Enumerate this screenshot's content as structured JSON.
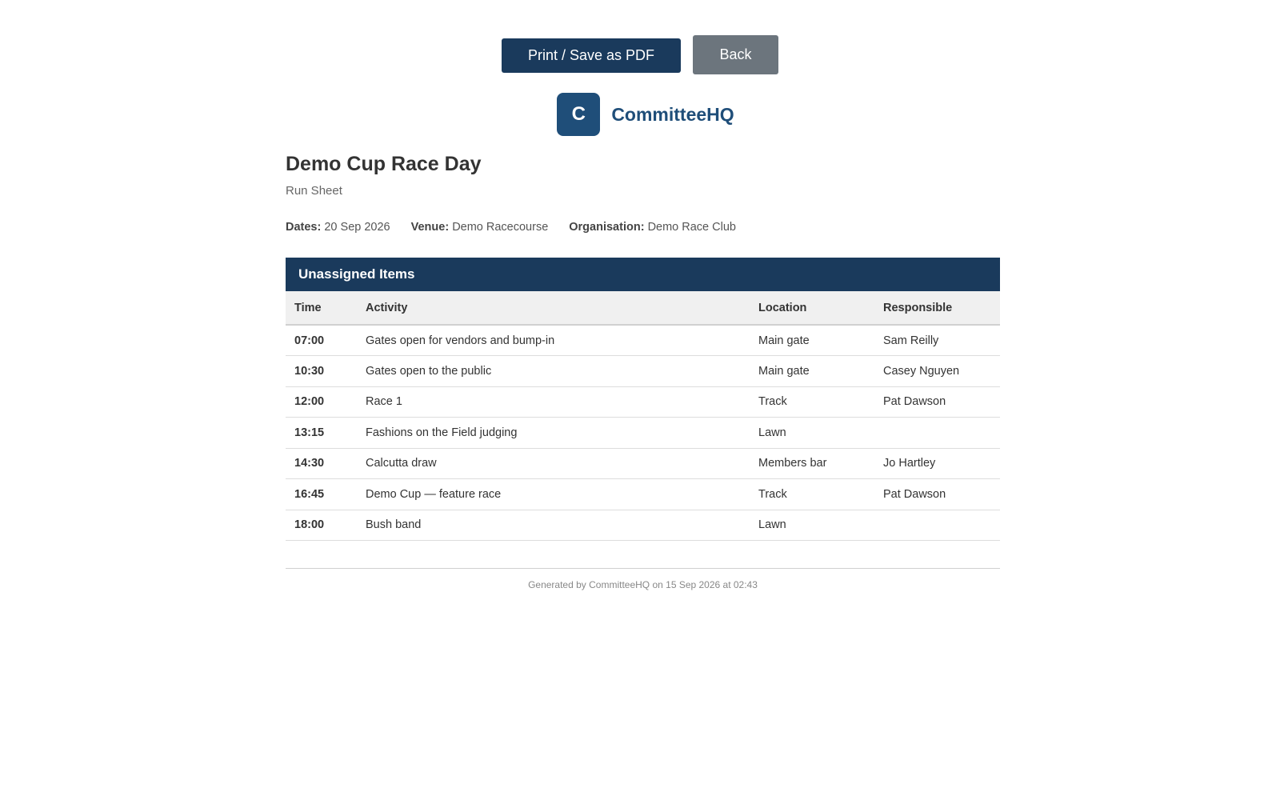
{
  "toolbar": {
    "print_label": "Print / Save as PDF",
    "back_label": "Back"
  },
  "brand": {
    "logo_letter": "C",
    "name": "CommitteeHQ"
  },
  "event": {
    "title": "Demo Cup Race Day",
    "subtitle": "Run Sheet",
    "dates_label": "Dates:",
    "dates": "20 Sep 2026",
    "venue_label": "Venue:",
    "venue": "Demo Racecourse",
    "organisation_label": "Organisation:",
    "organisation": "Demo Race Club"
  },
  "section": {
    "title": "Unassigned Items",
    "columns": [
      "Time",
      "Activity",
      "Location",
      "Responsible"
    ],
    "rows": [
      {
        "time": "07:00",
        "activity": "Gates open for vendors and bump-in",
        "location": "Main gate",
        "responsible": "Sam Reilly"
      },
      {
        "time": "10:30",
        "activity": "Gates open to the public",
        "location": "Main gate",
        "responsible": "Casey Nguyen"
      },
      {
        "time": "12:00",
        "activity": "Race 1",
        "location": "Track",
        "responsible": "Pat Dawson"
      },
      {
        "time": "13:15",
        "activity": "Fashions on the Field judging",
        "location": "Lawn",
        "responsible": ""
      },
      {
        "time": "14:30",
        "activity": "Calcutta draw",
        "location": "Members bar",
        "responsible": "Jo Hartley"
      },
      {
        "time": "16:45",
        "activity": "Demo Cup — feature race",
        "location": "Track",
        "responsible": "Pat Dawson"
      },
      {
        "time": "18:00",
        "activity": "Bush band",
        "location": "Lawn",
        "responsible": ""
      }
    ]
  },
  "footer": {
    "text": "Generated by CommitteeHQ on 15 Sep 2026 at 02:43"
  },
  "colors": {
    "primary": "#1a3a5c",
    "brand": "#1f4e79",
    "secondary_button": "#6c757d"
  }
}
